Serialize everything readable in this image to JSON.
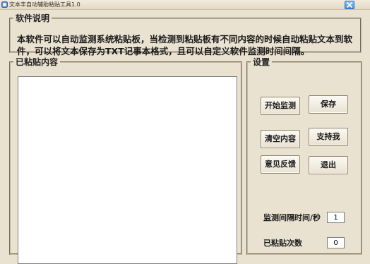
{
  "window": {
    "title": "文本丰自动辅助粘贴工具1.0"
  },
  "description": {
    "legend": "软件说明",
    "text": "本软件可以自动监测系统粘贴板，当检测到粘贴板有不同内容的时候自动粘贴文本到软件，可以将文本保存为TXT记事本格式，且可以自定义软件监测时间间隔。"
  },
  "pasted": {
    "legend": "已粘贴内容",
    "content": ""
  },
  "settings": {
    "legend": "设置",
    "buttons": {
      "start": "开始监测",
      "save": "保存",
      "clear": "清空内容",
      "support": "支持我",
      "feedback": "意见反馈",
      "exit": "退出"
    },
    "interval_label": "监测间隔时间/秒",
    "interval_value": "1",
    "count_label": "已粘贴次数",
    "count_value": "0"
  },
  "colors": {
    "window_bg": "#eae2d1",
    "close_button": "#3d8fe6"
  }
}
